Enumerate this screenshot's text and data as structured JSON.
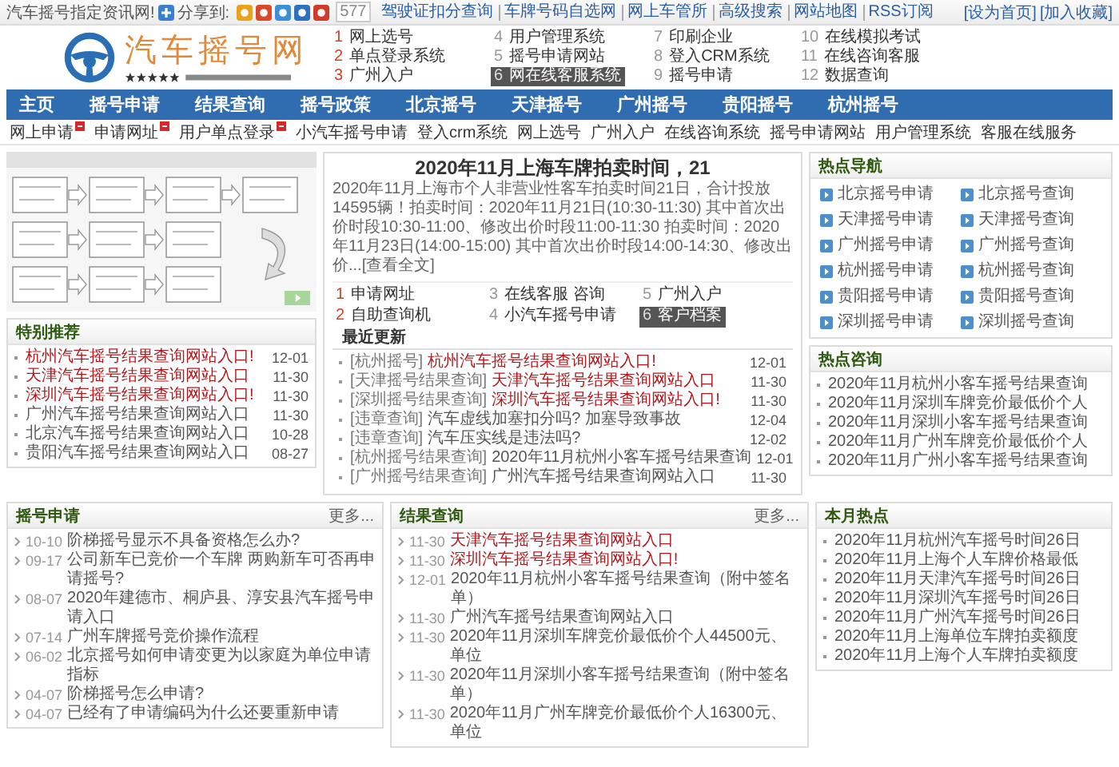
{
  "top_bar": {
    "slogan": "汽车摇号指定资讯网!",
    "share_label": "分享到:",
    "share_count": "577",
    "links": [
      "驾驶证扣分查询",
      "车牌号码自选网",
      "网上车管所",
      "高级搜索",
      "网站地图",
      "RSS订阅"
    ],
    "actions": [
      "[设为首页]",
      "[加入收藏]"
    ]
  },
  "header": {
    "site_name": "汽车摇号网",
    "quick_links": [
      {
        "number": "1",
        "label": "网上选号",
        "hot": true,
        "highlighted": false
      },
      {
        "number": "2",
        "label": "单点登录系统",
        "hot": true,
        "highlighted": false
      },
      {
        "number": "3",
        "label": "广州入户",
        "hot": true,
        "highlighted": false
      },
      {
        "number": "4",
        "label": "用户管理系统",
        "hot": false,
        "highlighted": false
      },
      {
        "number": "5",
        "label": "摇号申请网站",
        "hot": false,
        "highlighted": false
      },
      {
        "number": "6",
        "label": "网在线客服系统",
        "hot": false,
        "highlighted": true
      },
      {
        "number": "7",
        "label": "印刷企业",
        "hot": false,
        "highlighted": false
      },
      {
        "number": "8",
        "label": "登入CRM系统",
        "hot": false,
        "highlighted": false
      },
      {
        "number": "9",
        "label": "摇号申请",
        "hot": false,
        "highlighted": false
      },
      {
        "number": "10",
        "label": "在线模拟考试",
        "hot": false,
        "highlighted": false
      },
      {
        "number": "11",
        "label": "在线咨询客服",
        "hot": false,
        "highlighted": false
      },
      {
        "number": "12",
        "label": "数据查询",
        "hot": false,
        "highlighted": false
      }
    ]
  },
  "nav": [
    "主页",
    "摇号申请",
    "结果查询",
    "摇号政策",
    "北京摇号",
    "天津摇号",
    "广州摇号",
    "贵阳摇号",
    "杭州摇号"
  ],
  "subnav": [
    {
      "label": "网上申请",
      "new": true
    },
    {
      "label": "申请网址",
      "new": true
    },
    {
      "label": "用户单点登录",
      "new": true
    },
    {
      "label": "小汽车摇号申请",
      "new": false
    },
    {
      "label": "登入crm系统",
      "new": false
    },
    {
      "label": "网上选号",
      "new": false
    },
    {
      "label": "广州入户",
      "new": false
    },
    {
      "label": "在线咨询系统",
      "new": false
    },
    {
      "label": "摇号申请网站",
      "new": false
    },
    {
      "label": "用户管理系统",
      "new": false
    },
    {
      "label": "客服在线服务",
      "new": false
    }
  ],
  "featured": {
    "title": "特别推荐",
    "items": [
      {
        "title": "杭州汽车摇号结果查询网站入口!",
        "date": "12-01",
        "hot": true
      },
      {
        "title": "天津汽车摇号结果查询网站入口",
        "date": "11-30",
        "hot": true
      },
      {
        "title": "深圳汽车摇号结果查询网站入口!",
        "date": "11-30",
        "hot": true
      },
      {
        "title": "广州汽车摇号结果查询网站入口",
        "date": "11-30",
        "hot": false
      },
      {
        "title": "北京汽车摇号结果查询网站入口",
        "date": "10-28",
        "hot": false
      },
      {
        "title": "贵阳汽车摇号结果查询网站入口",
        "date": "08-27",
        "hot": false
      }
    ]
  },
  "article": {
    "title": "2020年11月上海车牌拍卖时间，21",
    "summary": "2020年11月上海市个人非营业性客车拍卖时间21日，合计投放14595辆！拍卖时间：2020年11月21日(10:30-11:30) 其中首次出价时段10:30-11:00、修改出价时段11:00-11:30 拍卖时间：2020年11月23日(14:00-15:00) 其中首次出价时段14:00-14:30、修改出价...",
    "more": "[查看全文]",
    "links": [
      {
        "number": "1",
        "label": "申请网址",
        "hot": true,
        "highlighted": false
      },
      {
        "number": "2",
        "label": "自助查询机",
        "hot": true,
        "highlighted": false
      },
      {
        "number": "3",
        "label": "在线客服 咨询",
        "hot": false,
        "highlighted": false
      },
      {
        "number": "4",
        "label": "小汽车摇号申请",
        "hot": false,
        "highlighted": false
      },
      {
        "number": "5",
        "label": "广州入户",
        "hot": false,
        "highlighted": false
      },
      {
        "number": "6",
        "label": "客户档案",
        "hot": false,
        "highlighted": true
      }
    ],
    "updates_title": "最近更新",
    "updates": [
      {
        "tag": "[杭州摇号]",
        "title": "杭州汽车摇号结果查询网站入口!",
        "date": "12-01",
        "hot": true
      },
      {
        "tag": "[天津摇号结果查询]",
        "title": "天津汽车摇号结果查询网站入口",
        "date": "11-30",
        "hot": true
      },
      {
        "tag": "[深圳摇号结果查询]",
        "title": "深圳汽车摇号结果查询网站入口!",
        "date": "11-30",
        "hot": true
      },
      {
        "tag": "[违章查询]",
        "title": "汽车虚线加塞扣分吗? 加塞导致事故",
        "date": "12-04",
        "hot": false
      },
      {
        "tag": "[违章查询]",
        "title": "汽车压实线是违法吗?",
        "date": "12-02",
        "hot": false
      },
      {
        "tag": "[杭州摇号结果查询]",
        "title": "2020年11月杭州小客车摇号结果查询",
        "date": "12-01",
        "hot": false
      },
      {
        "tag": "[广州摇号结果查询]",
        "title": "广州汽车摇号结果查询网站入口",
        "date": "11-30",
        "hot": false
      }
    ]
  },
  "hot_nav": {
    "title": "热点导航",
    "items": [
      "北京摇号申请",
      "北京摇号查询",
      "天津摇号申请",
      "天津摇号查询",
      "广州摇号申请",
      "广州摇号查询",
      "杭州摇号申请",
      "杭州摇号查询",
      "贵阳摇号申请",
      "贵阳摇号查询",
      "深圳摇号申请",
      "深圳摇号查询"
    ]
  },
  "hot_consult": {
    "title": "热点咨询",
    "items": [
      "2020年11月杭州小客车摇号结果查询",
      "2020年11月深圳车牌竞价最低价个人",
      "2020年11月深圳小客车摇号结果查询",
      "2020年11月广州车牌竞价最低价个人",
      "2020年11月广州小客车摇号结果查询"
    ]
  },
  "apply_news": {
    "title": "摇号申请",
    "more": "更多...",
    "items": [
      {
        "date": "10-10",
        "title": "阶梯摇号显示不具备资格怎么办?",
        "hot": false
      },
      {
        "date": "09-17",
        "title": "公司新车已竞价一个车牌 两购新车可否再申请摇号?",
        "hot": false
      },
      {
        "date": "08-07",
        "title": "2020年建德市、桐庐县、淳安县汽车摇号申请入口",
        "hot": false
      },
      {
        "date": "07-14",
        "title": "广州车牌摇号竞价操作流程",
        "hot": false
      },
      {
        "date": "06-02",
        "title": "北京摇号如何申请变更为以家庭为单位申请指标",
        "hot": false
      },
      {
        "date": "04-07",
        "title": "阶梯摇号怎么申请?",
        "hot": false
      },
      {
        "date": "04-07",
        "title": "已经有了申请编码为什么还要重新申请",
        "hot": false
      }
    ]
  },
  "results": {
    "title": "结果查询",
    "more": "更多...",
    "items": [
      {
        "date": "11-30",
        "title": "天津汽车摇号结果查询网站入口",
        "hot": true
      },
      {
        "date": "11-30",
        "title": "深圳汽车摇号结果查询网站入口!",
        "hot": true
      },
      {
        "date": "12-01",
        "title": "2020年11月杭州小客车摇号结果查询（附中签名单）",
        "hot": false
      },
      {
        "date": "11-30",
        "title": "广州汽车摇号结果查询网站入口",
        "hot": false
      },
      {
        "date": "11-30",
        "title": "2020年11月深圳车牌竞价最低价个人44500元、单位",
        "hot": false
      },
      {
        "date": "11-30",
        "title": "2020年11月深圳小客车摇号结果查询（附中签名单）",
        "hot": false
      },
      {
        "date": "11-30",
        "title": "2020年11月广州车牌竞价最低价个人16300元、单位",
        "hot": false
      }
    ]
  },
  "month_hot": {
    "title": "本月热点",
    "items": [
      "2020年11月杭州汽车摇号时间26日",
      "2020年11月上海个人车牌价格最低",
      "2020年11月天津汽车摇号时间26日",
      "2020年11月深圳汽车摇号时间26日",
      "2020年11月广州汽车摇号时间26日",
      "2020年11月上海单位车牌拍卖额度",
      "2020年11月上海个人车牌拍卖额度"
    ]
  }
}
